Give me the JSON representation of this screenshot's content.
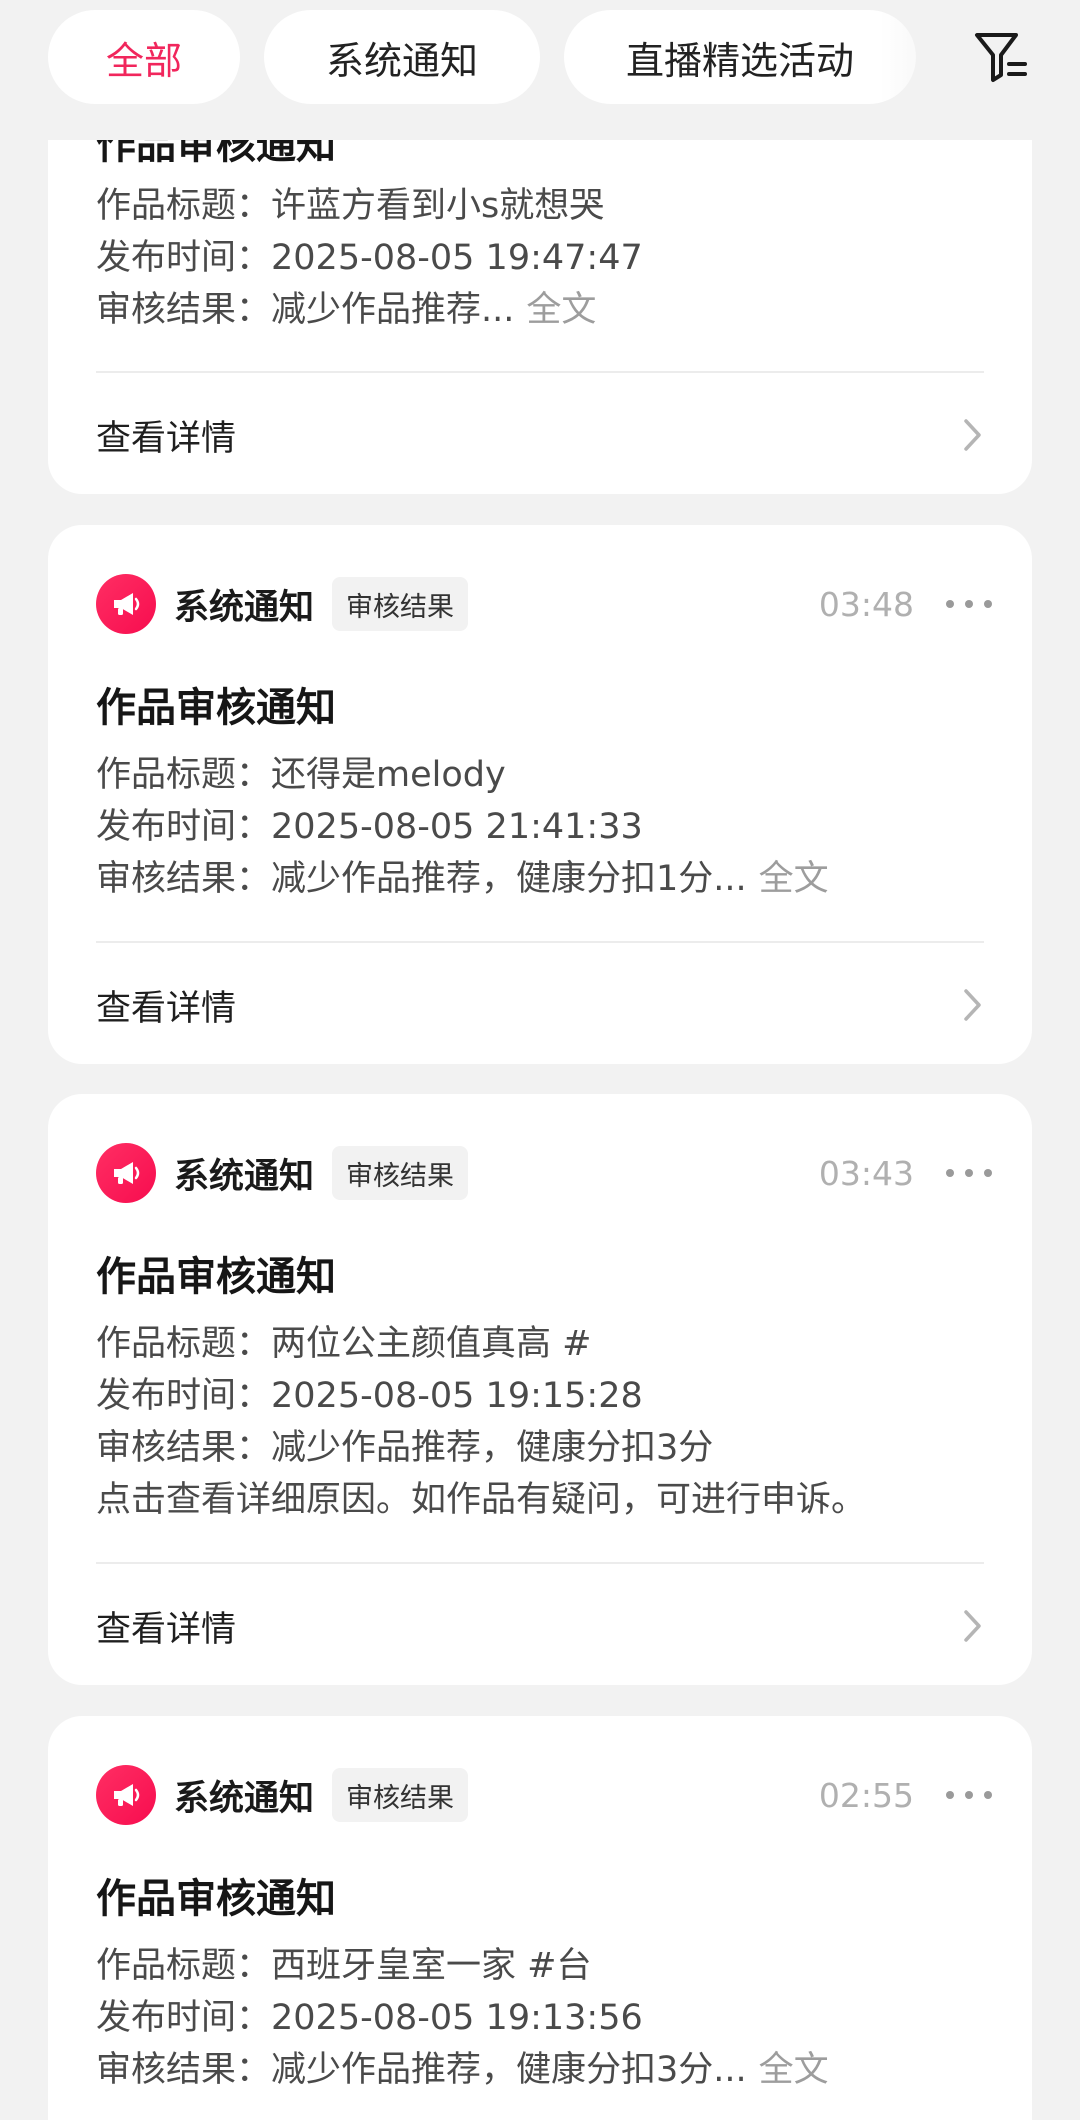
{
  "tabs": [
    {
      "label": "全部",
      "active": true
    },
    {
      "label": "系统通知",
      "active": false
    },
    {
      "label": "直播精选活动",
      "active": false
    }
  ],
  "icons": {
    "filter": "filter-icon",
    "app": "megaphone-icon",
    "more": "more-horizontal-icon",
    "chevron": "chevron-right-icon"
  },
  "colors": {
    "accent": "#f1265c",
    "background": "#f2f2f2",
    "card": "#ffffff"
  },
  "cards": [
    {
      "partial_title": "作品审核通知",
      "lines": [
        {
          "label": "作品标题：",
          "value": "许蓝方看到小s就想哭"
        },
        {
          "label": "发布时间：",
          "value": "2025-08-05 19:47:47"
        },
        {
          "label": "审核结果：",
          "value": "减少作品推荐...",
          "more": "全文"
        }
      ],
      "detail_label": "查看详情"
    },
    {
      "sender": "系统通知",
      "tag": "审核结果",
      "time": "03:48",
      "title": "作品审核通知",
      "lines": [
        {
          "label": "作品标题：",
          "value": "还得是melody"
        },
        {
          "label": "发布时间：",
          "value": "2025-08-05 21:41:33"
        },
        {
          "label": "审核结果：",
          "value": "减少作品推荐，健康分扣1分...",
          "more": "全文"
        }
      ],
      "detail_label": "查看详情"
    },
    {
      "sender": "系统通知",
      "tag": "审核结果",
      "time": "03:43",
      "title": "作品审核通知",
      "lines": [
        {
          "label": "作品标题：",
          "value": "两位公主颜值真高 #"
        },
        {
          "label": "发布时间：",
          "value": "2025-08-05 19:15:28"
        },
        {
          "label": "审核结果：",
          "value": "减少作品推荐，健康分扣3分"
        },
        {
          "label": "",
          "value": "点击查看详细原因。如作品有疑问，可进行申诉。"
        }
      ],
      "detail_label": "查看详情"
    },
    {
      "sender": "系统通知",
      "tag": "审核结果",
      "time": "02:55",
      "title": "作品审核通知",
      "lines": [
        {
          "label": "作品标题：",
          "value": "西班牙皇室一家 #台"
        },
        {
          "label": "发布时间：",
          "value": "2025-08-05 19:13:56"
        },
        {
          "label": "审核结果：",
          "value": "减少作品推荐，健康分扣3分...",
          "more": "全文"
        }
      ]
    }
  ]
}
